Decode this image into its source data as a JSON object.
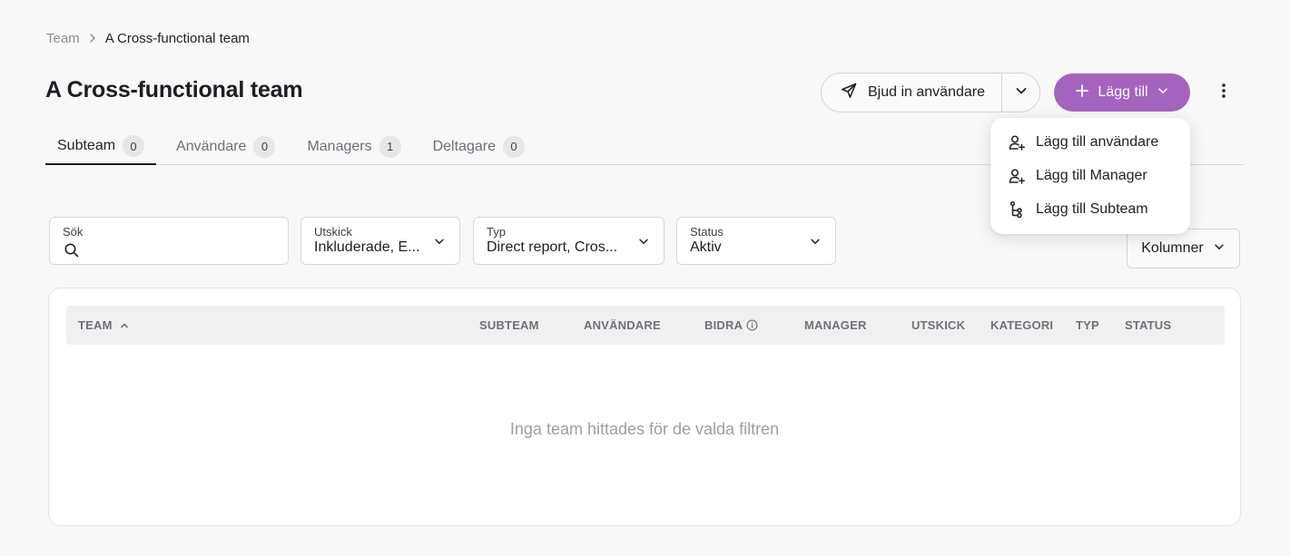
{
  "breadcrumb": {
    "parent": "Team",
    "current": "A Cross-functional team"
  },
  "page": {
    "title": "A Cross-functional team"
  },
  "actions": {
    "invite_label": "Bjud in användare",
    "add_label": "Lägg till",
    "accent_color": "#a463bf"
  },
  "tabs": [
    {
      "label": "Subteam",
      "count": "0"
    },
    {
      "label": "Användare",
      "count": "0"
    },
    {
      "label": "Managers",
      "count": "1"
    },
    {
      "label": "Deltagare",
      "count": "0"
    }
  ],
  "add_menu": {
    "items": [
      {
        "label": "Lägg till användare",
        "icon": "user-plus-icon"
      },
      {
        "label": "Lägg till Manager",
        "icon": "user-plus-icon"
      },
      {
        "label": "Lägg till Subteam",
        "icon": "hierarchy-icon"
      }
    ]
  },
  "filters": {
    "search": {
      "label": "Sök",
      "value": ""
    },
    "utskick": {
      "label": "Utskick",
      "value": "Inkluderade, E..."
    },
    "typ": {
      "label": "Typ",
      "value": "Direct report, Cros..."
    },
    "status": {
      "label": "Status",
      "value": "Aktiv"
    }
  },
  "columns_button": {
    "label": "Kolumner"
  },
  "table": {
    "columns": [
      "TEAM",
      "SUBTEAM",
      "ANVÄNDARE",
      "BIDRA",
      "MANAGER",
      "UTSKICK",
      "KATEGORI",
      "TYP",
      "STATUS"
    ],
    "empty_message": "Inga team hittades för de valda filtren"
  }
}
